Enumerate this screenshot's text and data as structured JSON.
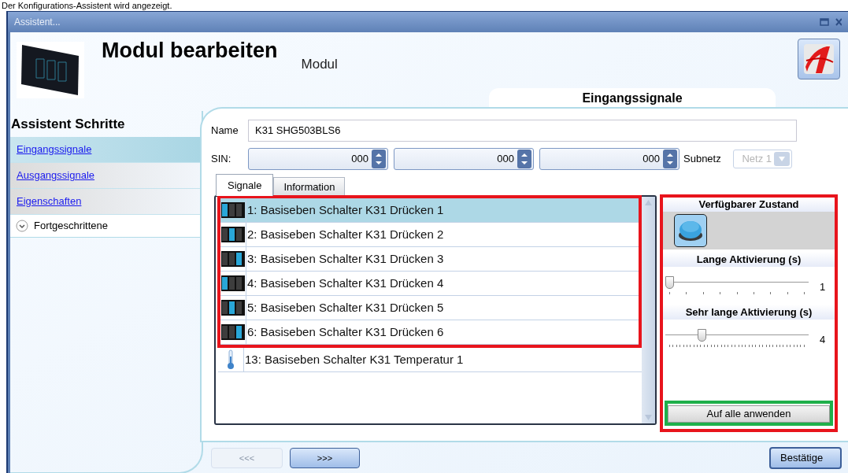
{
  "caption": "Der Konfigurations-Assistent wird angezeigt.",
  "window": {
    "title": "Assistent..."
  },
  "header": {
    "title": "Modul bearbeiten",
    "subtitle": "Modul",
    "section_tab": "Eingangssignale"
  },
  "sidebar": {
    "heading": "Assistent Schritte",
    "items": [
      {
        "label": "Eingangssignale",
        "kind": "link",
        "selected": true
      },
      {
        "label": "Ausgangssignale",
        "kind": "link",
        "selected": false
      },
      {
        "label": "Eigenschaften",
        "kind": "link",
        "selected": false
      },
      {
        "label": "Fortgeschrittene",
        "kind": "expander",
        "selected": false
      }
    ]
  },
  "form": {
    "name_label": "Name",
    "name_value": "K31 SHG503BLS6",
    "sin_label": "SIN:",
    "sin_values": [
      "000",
      "000",
      "000"
    ],
    "subnet_label": "Subnetz",
    "subnet_value": "Netz 1",
    "subnet_disabled": true
  },
  "tabs": [
    {
      "label": "Signale",
      "selected": true
    },
    {
      "label": "Information",
      "selected": false
    }
  ],
  "signals": [
    {
      "label": "1: Basiseben Schalter K31 Drücken 1",
      "kind": "button",
      "selected": true
    },
    {
      "label": "2: Basiseben Schalter K31 Drücken 2",
      "kind": "button",
      "selected": false
    },
    {
      "label": "3: Basiseben Schalter K31 Drücken 3",
      "kind": "button",
      "selected": false
    },
    {
      "label": "4: Basiseben Schalter K31 Drücken 4",
      "kind": "button",
      "selected": false
    },
    {
      "label": "5: Basiseben Schalter K31 Drücken 5",
      "kind": "button",
      "selected": false
    },
    {
      "label": "6: Basiseben Schalter K31 Drücken 6",
      "kind": "button",
      "selected": false
    },
    {
      "label": "13: Basiseben Schalter K31 Temperatur 1",
      "kind": "temperature",
      "selected": false
    }
  ],
  "state_panel": {
    "heading": "Verfügbarer Zustand",
    "sliders": [
      {
        "label": "Lange Aktivierung (s)",
        "level": 0,
        "reading": "1"
      },
      {
        "label": "Sehr lange Aktivierung (s)",
        "level": 0.24,
        "reading": "4"
      }
    ],
    "apply_button": "Auf alle anwenden"
  },
  "nav": {
    "back": "<<<",
    "back_disabled": true,
    "next": ">>>",
    "confirm": "Bestätige"
  }
}
